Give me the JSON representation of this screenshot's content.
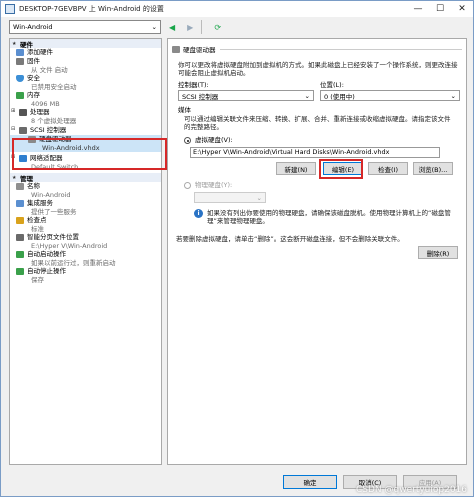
{
  "window": {
    "title": "DESKTOP-7GEVBPV 上 Win-Android 的设置"
  },
  "toolbar": {
    "vm_name": "Win-Android"
  },
  "sidebar": {
    "hardware_header": "硬件",
    "hardware": [
      {
        "label": "添加硬件",
        "sub": ""
      },
      {
        "label": "固件",
        "sub": "从 文件 启动"
      },
      {
        "label": "安全",
        "sub": "已禁用安全启动"
      },
      {
        "label": "内存",
        "sub": "4096 MB"
      },
      {
        "label": "处理器",
        "sub": "8 个虚拟处理器"
      },
      {
        "label": "SCSI 控制器",
        "sub": ""
      },
      {
        "label": "硬盘驱动器",
        "sub": "Win-Android.vhdx"
      },
      {
        "label": "网络适配器",
        "sub": "Default Switch"
      }
    ],
    "management_header": "管理",
    "management": [
      {
        "label": "名称",
        "sub": "Win-Android"
      },
      {
        "label": "集成服务",
        "sub": "提供了一些服务"
      },
      {
        "label": "检查点",
        "sub": "标准"
      },
      {
        "label": "智能分页文件位置",
        "sub": "E:\\Hyper V\\Win-Android"
      },
      {
        "label": "自动启动操作",
        "sub": "如果以前运行过，则重新启动"
      },
      {
        "label": "自动停止操作",
        "sub": "保存"
      }
    ]
  },
  "panel": {
    "header": "硬盘驱动器",
    "intro": "你可以更改将虚拟硬盘附加到虚拟机的方式。如果此磁盘上已经安装了一个操作系统，则更改连接可能会阻止虚拟机启动。",
    "controller_label": "控制器(T):",
    "controller_value": "SCSI 控制器",
    "location_label": "位置(L):",
    "location_value": "0 (使用中)",
    "media_label": "媒体",
    "media_desc": "可以通过编辑关联文件来压缩、转换、扩展、合并、重新连接或收缩虚拟硬盘。请指定该文件的完整路径。",
    "vhd_label": "虚拟硬盘(V):",
    "vhd_path": "E:\\Hyper V\\Win-Android\\Virtual Hard Disks\\Win-Android.vhdx",
    "new_btn": "新建(N)",
    "edit_btn": "编辑(E)",
    "inspect_btn": "检查(I)",
    "browse_btn": "浏览(B)...",
    "physical_label": "物理硬盘(Y):",
    "physical_note": "如果没有列出你要使用的物理硬盘，请确保该磁盘脱机。使用物理计算机上的“磁盘管理”来管理物理硬盘。",
    "remove_note": "若要删除虚拟硬盘，请单击“删除”。这会断开磁盘连接，但不会删除关联文件。",
    "remove_btn": "删除(R)"
  },
  "footer": {
    "ok": "确定",
    "cancel": "取消(C)",
    "apply": "应用(A)"
  },
  "watermark": "CSDN @qwertyuiop2016"
}
